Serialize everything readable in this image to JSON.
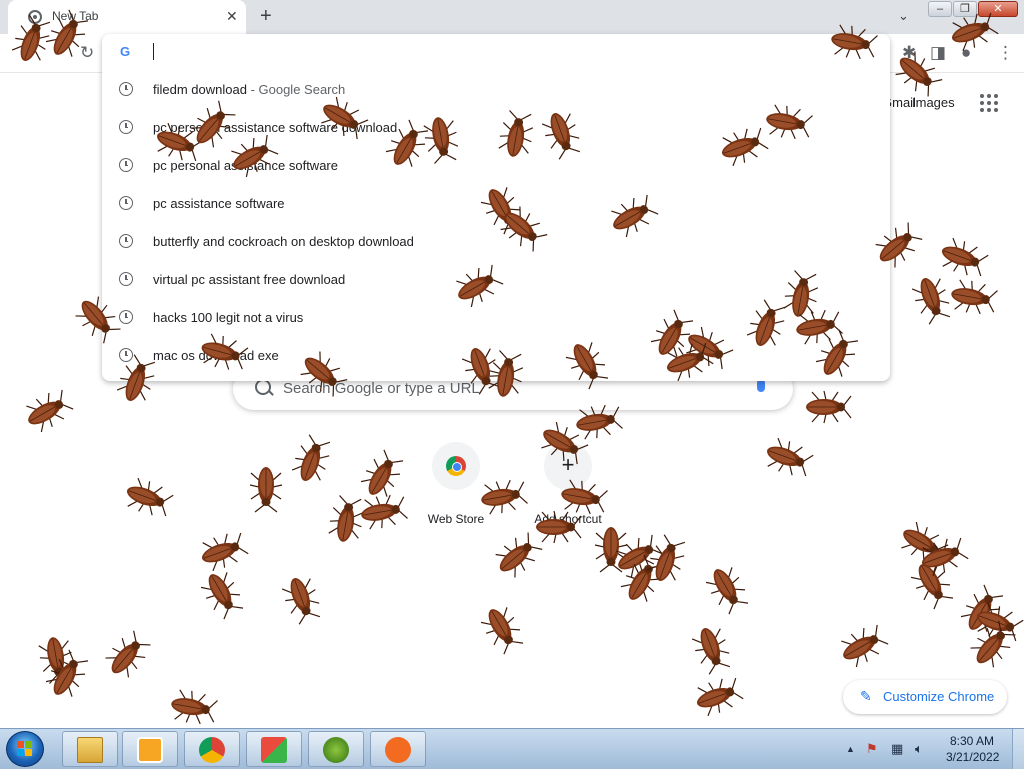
{
  "browser": {
    "tab": {
      "title": "New Tab",
      "close": "✕"
    },
    "new_tab": "+",
    "tab_search": "⌄",
    "window_controls": [
      "–",
      "❐",
      "✕"
    ]
  },
  "omnibox": {
    "google_letter": "G",
    "value": "",
    "suggestions": [
      {
        "text": "filedm download",
        "secondary": " - Google Search"
      },
      {
        "text": "pc personal assistance software download",
        "secondary": ""
      },
      {
        "text": "pc personal assistance software",
        "secondary": ""
      },
      {
        "text": "pc assistance software",
        "secondary": ""
      },
      {
        "text": "butterfly and cockroach on desktop download",
        "secondary": ""
      },
      {
        "text": "virtual pc assistant free download",
        "secondary": ""
      },
      {
        "text": "hacks 100 legit not a virus",
        "secondary": ""
      },
      {
        "text": "mac os download exe",
        "secondary": ""
      }
    ]
  },
  "ntp": {
    "gmail": "Gmail",
    "images": "Images",
    "search_placeholder": "Search Google or type a URL",
    "shortcuts": [
      {
        "label": "Web Store",
        "icon": "web-store-icon"
      },
      {
        "label": "Add shortcut",
        "icon": "plus-icon"
      }
    ],
    "customize": "Customize Chrome"
  },
  "taskbar": {
    "apps": [
      "explorer-icon",
      "media-player-icon",
      "chrome-icon",
      "paint-icon",
      "app-shield-icon",
      "avast-icon"
    ],
    "tray_arrow": "▲",
    "time": "8:30 AM",
    "date": "3/21/2022"
  },
  "colors": {
    "roach_body": "#7a3414",
    "roach_wing": "#a0522d",
    "taskbar": "#b5cce4"
  }
}
